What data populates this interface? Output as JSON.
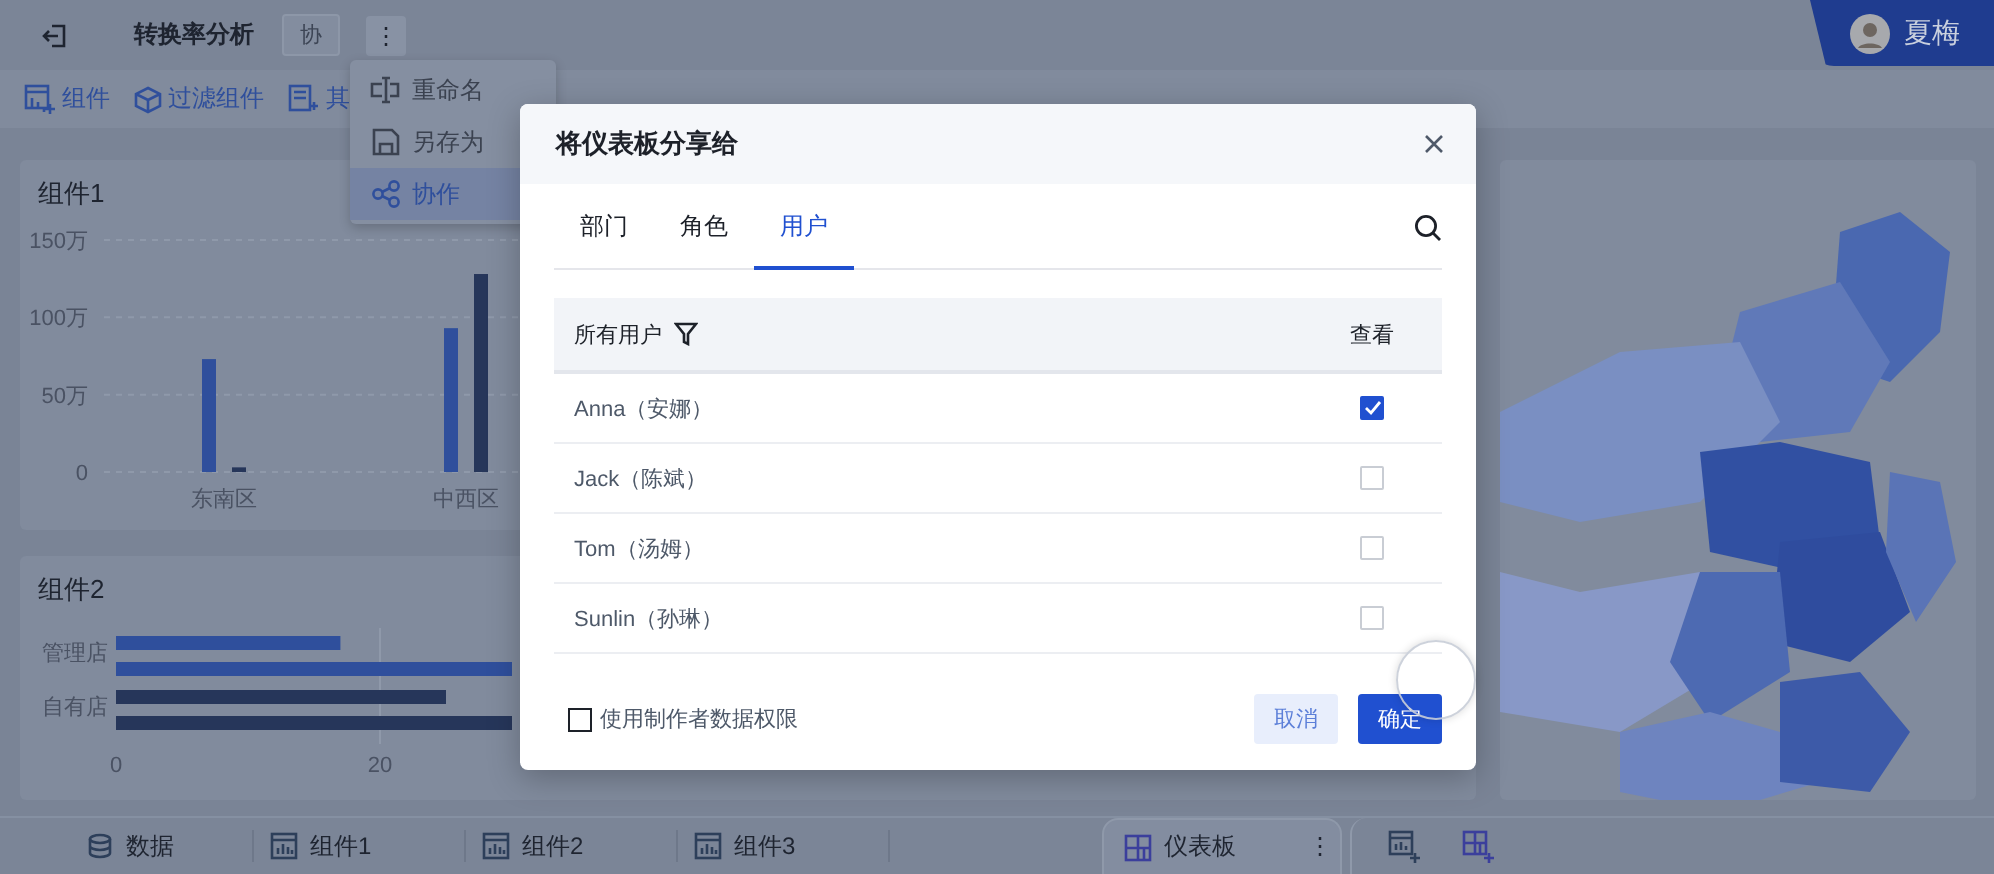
{
  "topbar": {
    "title": "转换率分析",
    "badge": "协",
    "more": "⋮",
    "user": {
      "name": "夏梅"
    }
  },
  "toolbar": {
    "items": [
      {
        "label": "组件",
        "kind": "component"
      },
      {
        "label": "过滤组件",
        "kind": "filter"
      },
      {
        "label": "其",
        "kind": "other"
      }
    ]
  },
  "menu": {
    "items": [
      {
        "label": "重命名",
        "kind": "rename",
        "selected": false
      },
      {
        "label": "另存为",
        "kind": "save",
        "selected": false
      },
      {
        "label": "协作",
        "kind": "share",
        "selected": true
      }
    ]
  },
  "widgets": [
    {
      "title": "组件1",
      "chart_data": {
        "type": "bar",
        "categories": [
          "东南区",
          "中西区"
        ],
        "ylim": [
          0,
          150
        ],
        "yticks": [
          {
            "value": 0,
            "label": "0"
          },
          {
            "value": 50,
            "label": "50万"
          },
          {
            "value": 100,
            "label": "100万"
          },
          {
            "value": 150,
            "label": "150万"
          }
        ],
        "series": [
          {
            "color": "#2f4f9c",
            "values": [
              73,
              93
            ]
          },
          {
            "color": "#26365a",
            "values": [
              3,
              128
            ]
          }
        ]
      }
    },
    {
      "title": "组件2",
      "chart_data": {
        "type": "bar",
        "orientation": "horizontal",
        "categories": [
          "管理店",
          "自有店"
        ],
        "xlim": [
          0,
          30
        ],
        "xticks": [
          0,
          20
        ],
        "series": [
          {
            "color": "#2f4f9c",
            "values": [
              17,
              null
            ]
          },
          {
            "color": "#2f4f9c",
            "values": [
              30,
              null
            ]
          },
          {
            "color": "#26365a",
            "values": [
              null,
              25
            ]
          },
          {
            "color": "#26365a",
            "values": [
              null,
              30
            ]
          }
        ]
      }
    }
  ],
  "dialog": {
    "title": "将仪表板分享给",
    "tabs": [
      {
        "label": "部门",
        "selected": false
      },
      {
        "label": "角色",
        "selected": false
      },
      {
        "label": "用户",
        "selected": true
      }
    ],
    "columns": [
      "所有用户",
      "查看"
    ],
    "rows": [
      {
        "name": "Anna（安娜）",
        "checked": true
      },
      {
        "name": "Jack（陈斌）",
        "checked": false
      },
      {
        "name": "Tom（汤姆）",
        "checked": false
      },
      {
        "name": "Sunlin（孙琳）",
        "checked": false
      }
    ],
    "option": {
      "label": "使用制作者数据权限",
      "checked": false
    },
    "buttons": [
      {
        "label": "取消",
        "kind": "secondary"
      },
      {
        "label": "确定",
        "kind": "primary"
      }
    ]
  },
  "bottom_tabs": {
    "tabs": [
      {
        "label": "数据",
        "kind": "data",
        "selected": false
      },
      {
        "label": "组件1",
        "kind": "chart",
        "selected": false
      },
      {
        "label": "组件2",
        "kind": "chart",
        "selected": false
      },
      {
        "label": "组件3",
        "kind": "chart",
        "selected": false
      },
      {
        "label": "仪表板",
        "kind": "dashboard",
        "selected": true
      }
    ],
    "more": "⋮"
  }
}
